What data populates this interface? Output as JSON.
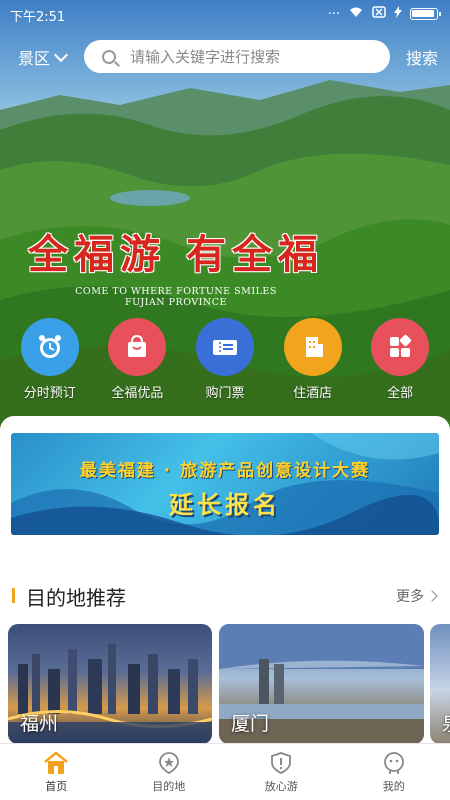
{
  "status_bar": {
    "time": "下午2:51",
    "battery_level": 0.9
  },
  "header": {
    "region_label": "景区",
    "search_placeholder": "请输入关键字进行搜索",
    "search_button": "搜索"
  },
  "hero": {
    "slogan": "全福游 有全福",
    "slogan_en_line1": "COME TO WHERE FORTUNE SMILES",
    "slogan_en_line2": "FUJIAN PROVINCE"
  },
  "quick_links": [
    {
      "label": "分时预订",
      "icon": "alarm-clock-icon",
      "color": "#3aa0e8"
    },
    {
      "label": "全福优品",
      "icon": "shopping-bag-icon",
      "color": "#e8505b"
    },
    {
      "label": "购门票",
      "icon": "ticket-icon",
      "color": "#3a6fd8"
    },
    {
      "label": "住酒店",
      "icon": "hotel-building-icon",
      "color": "#f2a51c"
    },
    {
      "label": "全部",
      "icon": "grid-apps-icon",
      "color": "#e8505b"
    }
  ],
  "banner": {
    "line1": "最美福建 · 旅游产品创意设计大赛",
    "line2": "延长报名"
  },
  "destinations": {
    "title": "目的地推荐",
    "more_label": "更多",
    "cards": [
      {
        "name": "福州"
      },
      {
        "name": "厦门"
      },
      {
        "name": "泉"
      }
    ]
  },
  "bottom_nav": [
    {
      "label": "首页",
      "icon": "home-icon",
      "active": true
    },
    {
      "label": "目的地",
      "icon": "destination-pin-icon",
      "active": false
    },
    {
      "label": "放心游",
      "icon": "shield-icon",
      "active": false
    },
    {
      "label": "我的",
      "icon": "profile-face-icon",
      "active": false
    }
  ],
  "colors": {
    "accent": "#f3a21e",
    "slogan_red": "#d7261e",
    "banner_blue": "#2a8fc8"
  }
}
